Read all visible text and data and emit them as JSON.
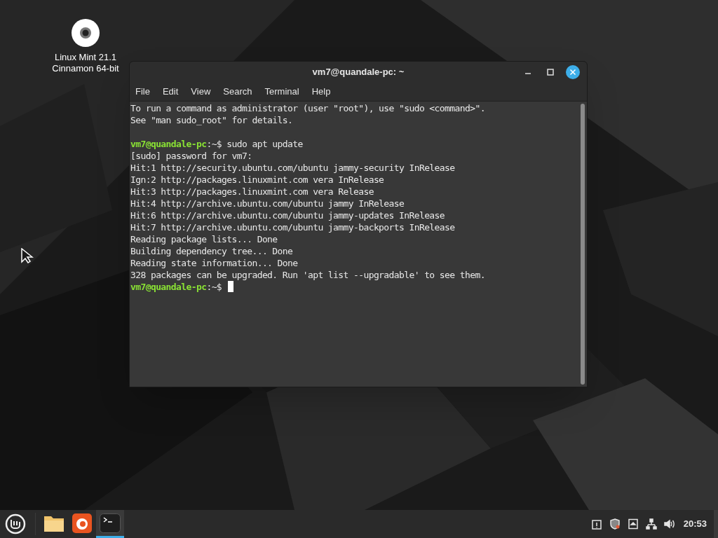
{
  "desktop_icons": [
    {
      "label": "Linux Mint 21.1\nCinnamon 64-bit"
    }
  ],
  "window": {
    "title": "vm7@quandale-pc: ~",
    "menu": [
      "File",
      "Edit",
      "View",
      "Search",
      "Terminal",
      "Help"
    ],
    "lines": [
      {
        "kind": "text",
        "text": "To run a command as administrator (user \"root\"), use \"sudo <command>\"."
      },
      {
        "kind": "text",
        "text": "See \"man sudo_root\" for details."
      },
      {
        "kind": "blank"
      },
      {
        "kind": "prompt",
        "user": "vm7@quandale-pc",
        "path": ":~$",
        "command": "sudo apt update",
        "cursor": false
      },
      {
        "kind": "text",
        "text": "[sudo] password for vm7:"
      },
      {
        "kind": "text",
        "text": "Hit:1 http://security.ubuntu.com/ubuntu jammy-security InRelease"
      },
      {
        "kind": "text",
        "text": "Ign:2 http://packages.linuxmint.com vera InRelease"
      },
      {
        "kind": "text",
        "text": "Hit:3 http://packages.linuxmint.com vera Release"
      },
      {
        "kind": "text",
        "text": "Hit:4 http://archive.ubuntu.com/ubuntu jammy InRelease"
      },
      {
        "kind": "text",
        "text": "Hit:6 http://archive.ubuntu.com/ubuntu jammy-updates InRelease"
      },
      {
        "kind": "text",
        "text": "Hit:7 http://archive.ubuntu.com/ubuntu jammy-backports InRelease"
      },
      {
        "kind": "text",
        "text": "Reading package lists... Done"
      },
      {
        "kind": "text",
        "text": "Building dependency tree... Done"
      },
      {
        "kind": "text",
        "text": "Reading state information... Done"
      },
      {
        "kind": "text",
        "text": "328 packages can be upgraded. Run 'apt list --upgradable' to see them."
      },
      {
        "kind": "prompt",
        "user": "vm7@quandale-pc",
        "path": ":~$",
        "cursor": true
      }
    ]
  },
  "taskbar": {
    "apps": [
      {
        "kind": "files",
        "active": false
      },
      {
        "kind": "firefox",
        "active": false
      },
      {
        "kind": "terminal",
        "active": true
      }
    ],
    "tray": [
      {
        "kind": "clipboard"
      },
      {
        "kind": "shield"
      },
      {
        "kind": "eject"
      },
      {
        "kind": "network"
      },
      {
        "kind": "volume"
      }
    ],
    "clock": "20:53"
  }
}
